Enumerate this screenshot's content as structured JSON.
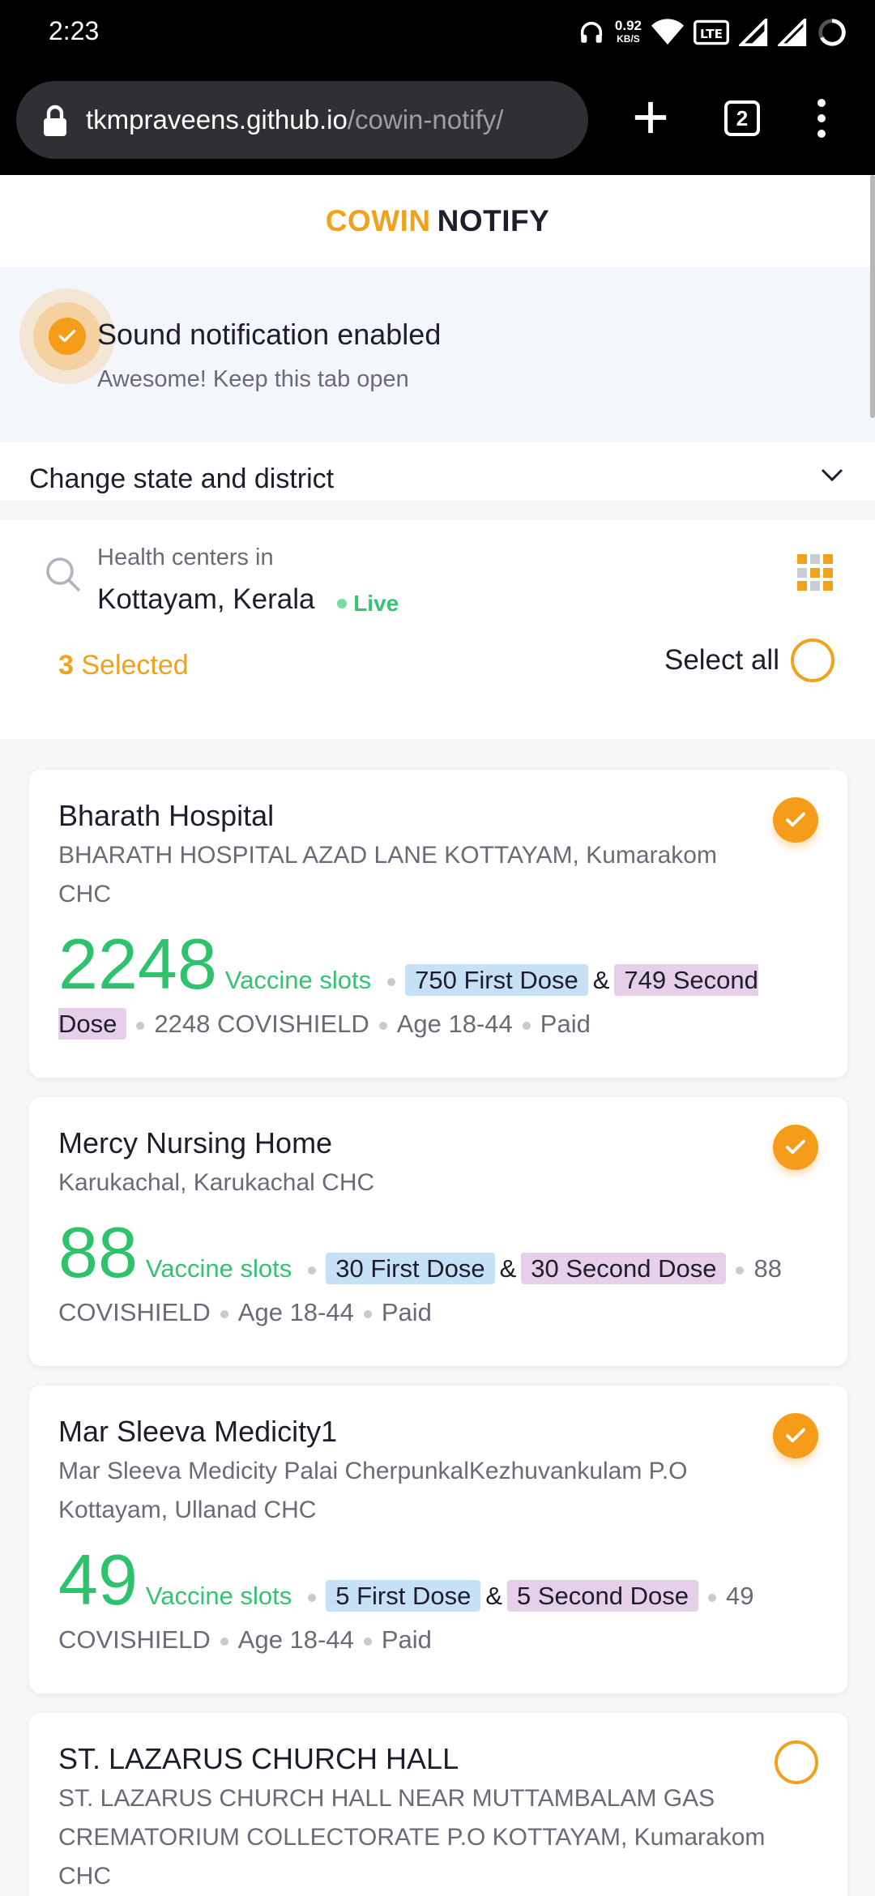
{
  "status_bar": {
    "time": "2:23",
    "speed_value": "0.92",
    "speed_unit": "KB/S",
    "volte": "Vo LTE 1"
  },
  "browser": {
    "url_domain": "tkmpraveens.github.io",
    "url_path": "/cowin-notify/",
    "tab_count": "2"
  },
  "header": {
    "brand_primary": "COWIN",
    "brand_secondary": "NOTIFY"
  },
  "notice": {
    "title": "Sound notification enabled",
    "subtitle": "Awesome! Keep this tab open"
  },
  "district": {
    "label": "Change state and district"
  },
  "search": {
    "label": "Health centers in",
    "location": "Kottayam, Kerala",
    "live": "Live"
  },
  "selection": {
    "count": "3",
    "count_label": "Selected",
    "select_all_label": "Select all"
  },
  "colors": {
    "accent": "#f0a21d",
    "green": "#2fc26d",
    "first_dose_bg": "#c6e1f5",
    "second_dose_bg": "#e6cfe8"
  },
  "centers": [
    {
      "name": "Bharath Hospital",
      "address": "BHARATH HOSPITAL AZAD LANE KOTTAYAM, Kumarakom CHC",
      "slots": "2248",
      "slots_label": "Vaccine slots",
      "first_dose": "750 First Dose",
      "second_dose": "749 Second Dose",
      "vaccine": "2248 COVISHIELD",
      "age": "Age 18-44",
      "fee": "Paid",
      "selected": true
    },
    {
      "name": "Mercy Nursing Home",
      "address": "Karukachal, Karukachal CHC",
      "slots": "88",
      "slots_label": "Vaccine slots",
      "first_dose": "30 First Dose",
      "second_dose": "30 Second Dose",
      "vaccine": "88 COVISHIELD",
      "age": "Age 18-44",
      "fee": "Paid",
      "selected": true
    },
    {
      "name": "Mar Sleeva Medicity1",
      "address": "Mar Sleeva Medicity Palai CherpunkalKezhuvankulam P.O Kottayam, Ullanad CHC",
      "slots": "49",
      "slots_label": "Vaccine slots",
      "first_dose": "5 First Dose",
      "second_dose": "5 Second Dose",
      "vaccine": "49 COVISHIELD",
      "age": "Age 18-44",
      "fee": "Paid",
      "selected": true
    },
    {
      "name": "ST. LAZARUS CHURCH HALL",
      "address": "ST. LAZARUS CHURCH HALL NEAR MUTTAMBALAM GAS CREMATORIUM COLLECTORATE P.O KOTTAYAM, Kumarakom CHC",
      "selected": false
    }
  ]
}
